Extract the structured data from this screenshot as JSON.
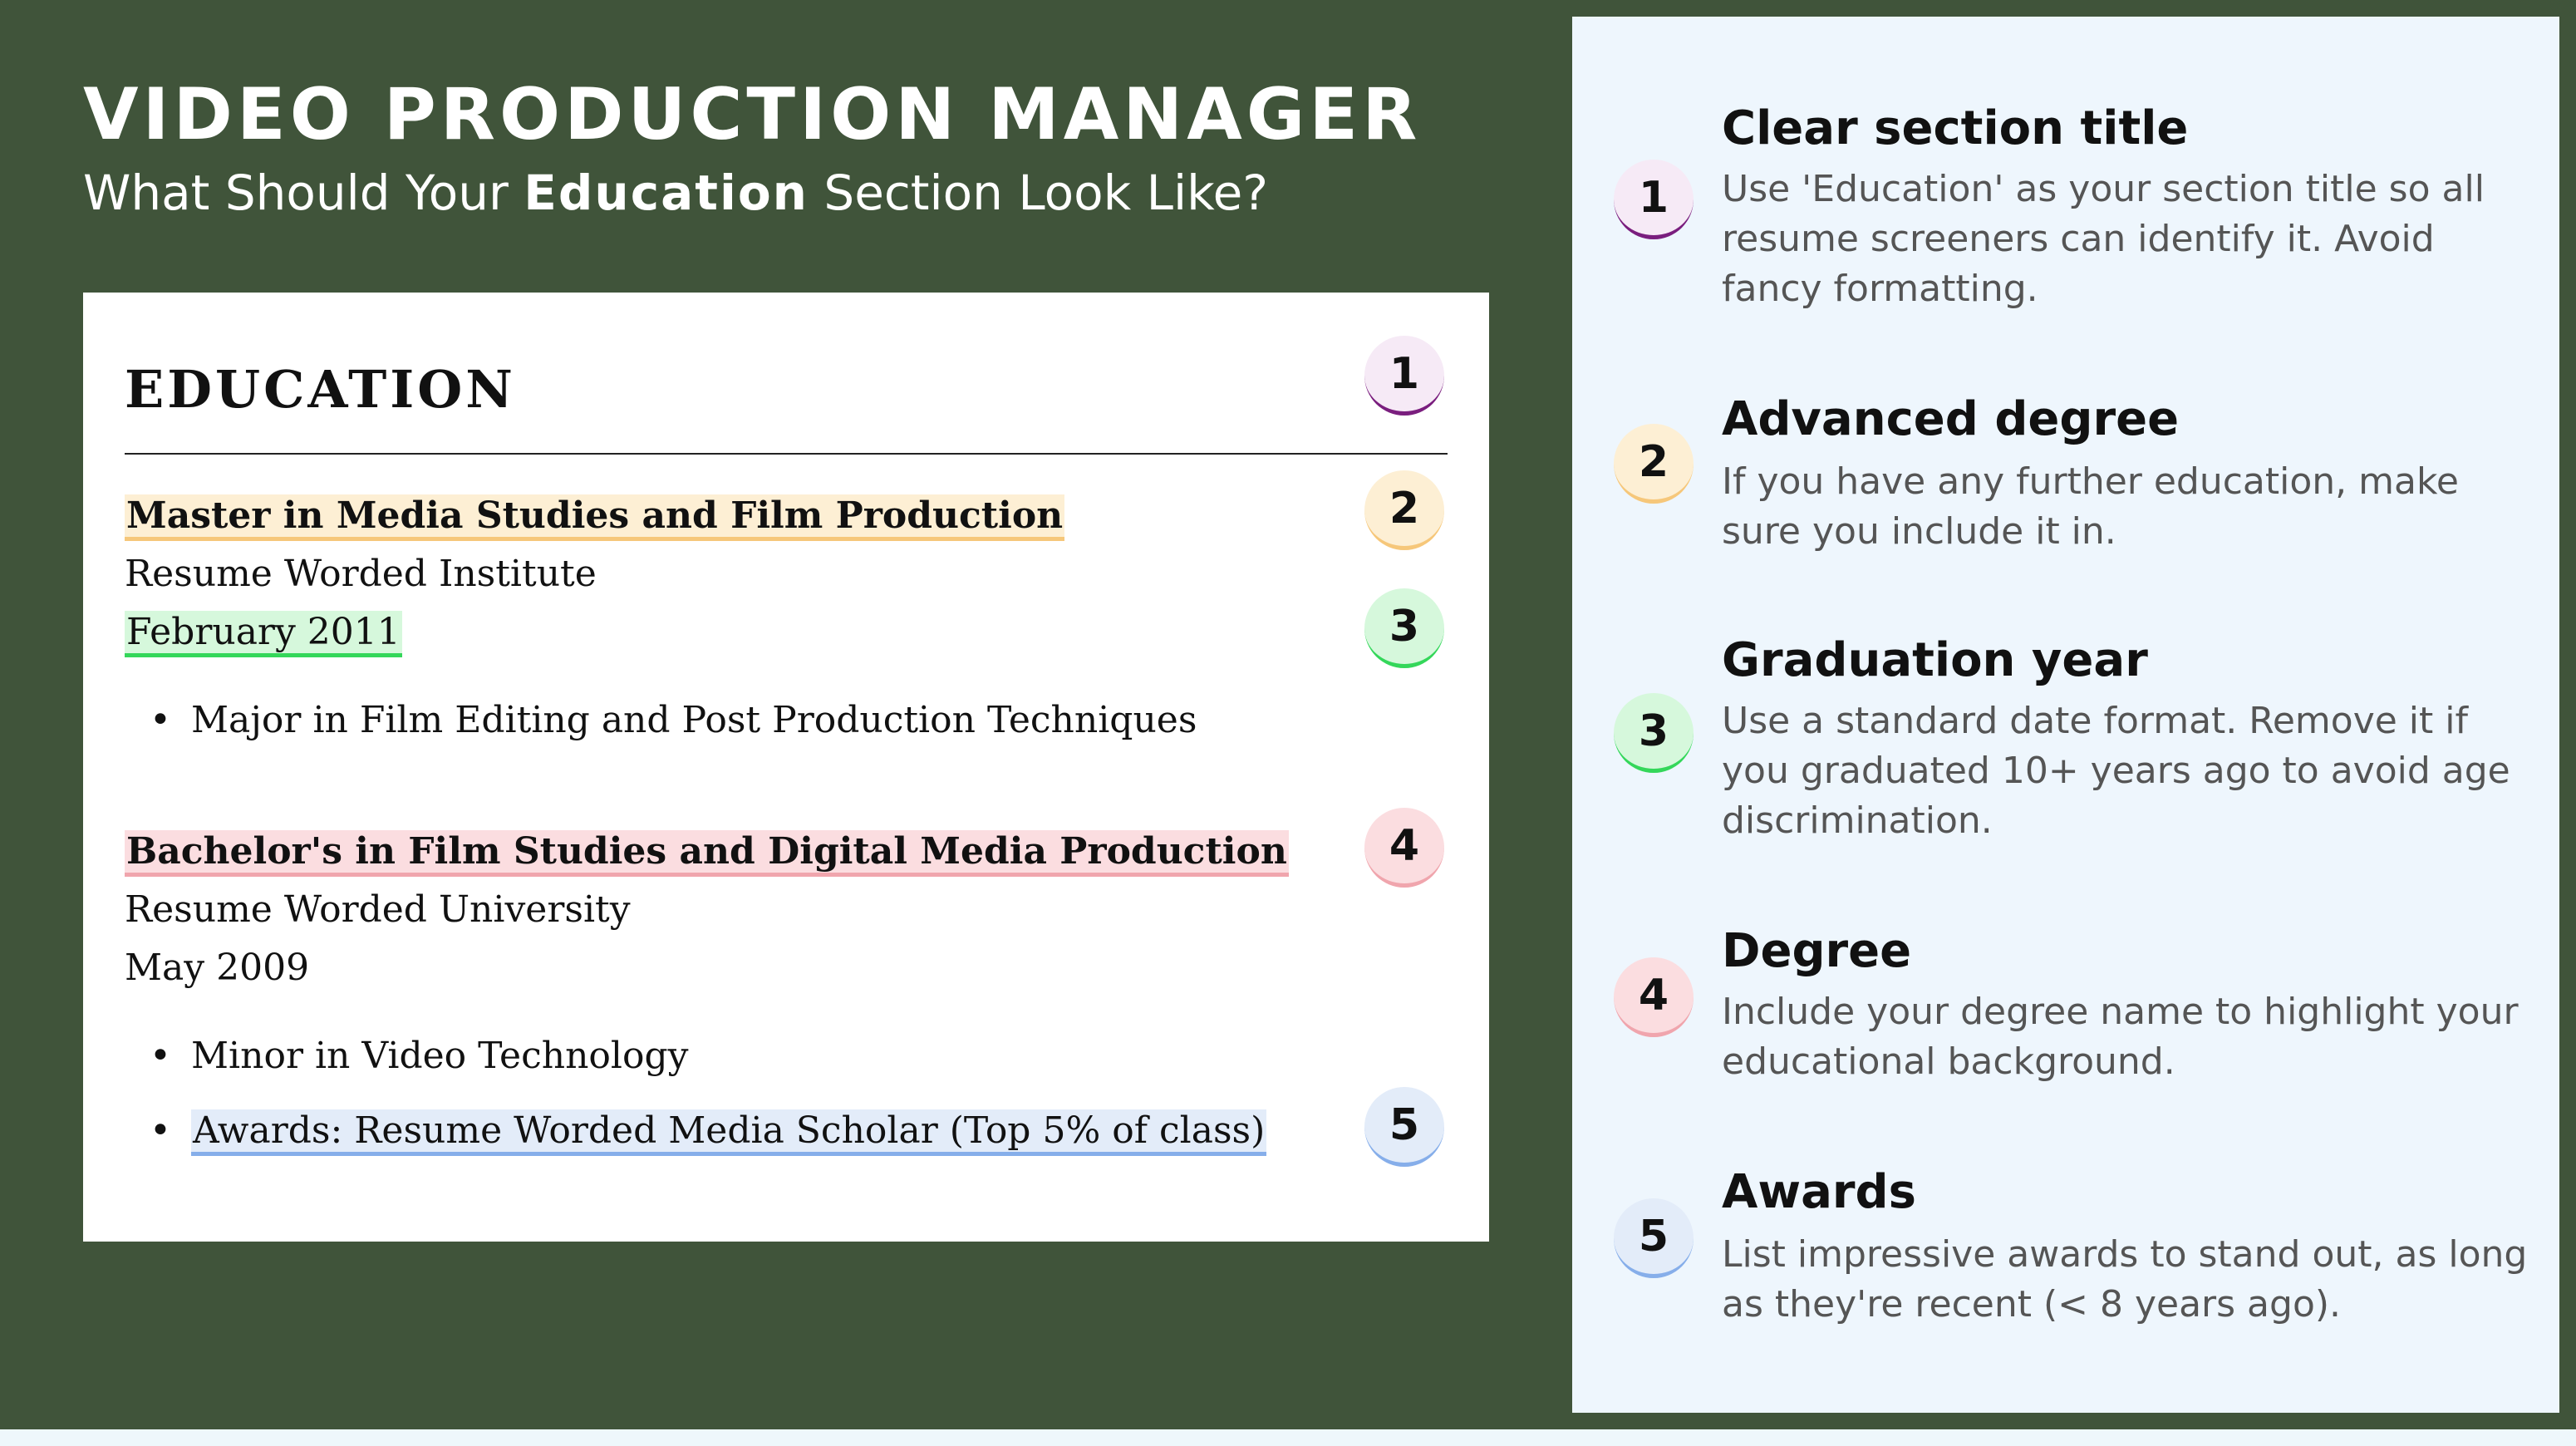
{
  "header": {
    "title": "VIDEO PRODUCTION MANAGER",
    "subtitle_before": "What Should Your ",
    "subtitle_emphasis": "Education",
    "subtitle_after": " Section Look Like?"
  },
  "resume": {
    "section_title": "EDUCATION",
    "entries": [
      {
        "degree": "Master in Media Studies and Film Production",
        "school": "Resume Worded Institute",
        "date": "February 2011",
        "bullets": [
          "Major in Film Editing and Post Production Techniques"
        ]
      },
      {
        "degree": "Bachelor's in Film Studies and Digital Media Production",
        "school": "Resume Worded University",
        "date": "May 2009",
        "bullets": [
          "Minor in Video Technology",
          "Awards: Resume Worded Media Scholar (Top 5% of class)"
        ]
      }
    ],
    "bullet_glyph": "•"
  },
  "badges": [
    "1",
    "2",
    "3",
    "4",
    "5"
  ],
  "tips": [
    {
      "number": "1",
      "title": "Clear section title",
      "body": "Use 'Education' as your section title so all resume screeners can identify it. Avoid fancy formatting."
    },
    {
      "number": "2",
      "title": "Advanced degree",
      "body": "If you have any further education, make sure you include it in."
    },
    {
      "number": "3",
      "title": "Graduation year",
      "body": "Use a standard date format. Remove it if you graduated 10+ years ago to avoid age discrimination."
    },
    {
      "number": "4",
      "title": "Degree",
      "body": "Include your degree name to highlight your educational background."
    },
    {
      "number": "5",
      "title": "Awards",
      "body": "List impressive awards to stand out, as long as they're recent (< 8 years ago)."
    }
  ],
  "colors": {
    "background_green": "#40543a",
    "panel_light": "#eef6fd",
    "badge_1": "#7a1e7e",
    "badge_2": "#f6c77a",
    "badge_3": "#34d75a",
    "badge_4": "#f0a5ad",
    "badge_5": "#86aeea"
  }
}
